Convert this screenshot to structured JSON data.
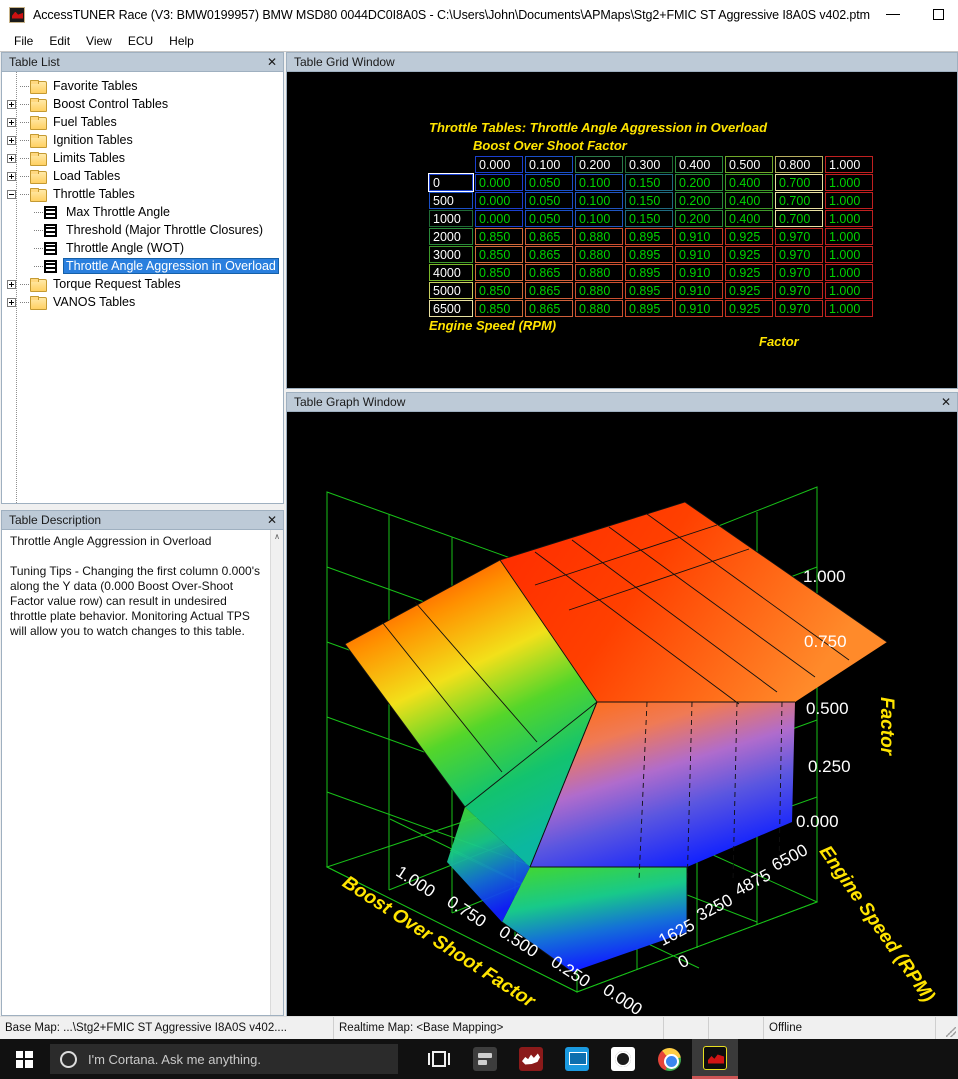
{
  "window": {
    "title": "AccessTUNER Race (V3: BMW0199957) BMW MSD80 0044DC0I8A0S - C:\\Users\\John\\Documents\\APMaps\\Stg2+FMIC ST Aggressive I8A0S v402.ptm",
    "icon": "accesstuner-icon",
    "minimize": "–",
    "maximize": "☐",
    "close": "✕"
  },
  "menu": [
    "File",
    "Edit",
    "View",
    "ECU",
    "Help"
  ],
  "table_list": {
    "header": "Table List",
    "close": "✕",
    "items": [
      {
        "label": "Favorite Tables",
        "type": "folder",
        "expander": "none",
        "selected": false
      },
      {
        "label": "Boost Control Tables",
        "type": "folder",
        "expander": "plus",
        "selected": false
      },
      {
        "label": "Fuel Tables",
        "type": "folder",
        "expander": "plus",
        "selected": false
      },
      {
        "label": "Ignition Tables",
        "type": "folder",
        "expander": "plus",
        "selected": false
      },
      {
        "label": "Limits Tables",
        "type": "folder",
        "expander": "plus",
        "selected": false
      },
      {
        "label": "Load Tables",
        "type": "folder",
        "expander": "plus",
        "selected": false
      },
      {
        "label": "Throttle Tables",
        "type": "folder",
        "expander": "minus",
        "selected": false
      },
      {
        "label": "Max Throttle Angle",
        "type": "table",
        "expander": "none",
        "selected": false
      },
      {
        "label": "Threshold (Major Throttle Closures)",
        "type": "table",
        "expander": "none",
        "selected": false
      },
      {
        "label": "Throttle Angle (WOT)",
        "type": "table",
        "expander": "none",
        "selected": false
      },
      {
        "label": "Throttle Angle Aggression in Overload",
        "type": "table",
        "expander": "none",
        "selected": true
      },
      {
        "label": "Torque Request Tables",
        "type": "folder",
        "expander": "plus",
        "selected": false
      },
      {
        "label": "VANOS Tables",
        "type": "folder",
        "expander": "plus",
        "selected": false
      }
    ]
  },
  "table_description": {
    "header": "Table Description",
    "close": "✕",
    "title": "Throttle Angle Aggression in Overload",
    "body": "Tuning Tips - Changing the first column 0.000's along the Y data (0.000 Boost Over-Shoot Factor value row) can result in undesired throttle plate behavior. Monitoring Actual TPS will allow you to watch changes to this table.",
    "scroll_up": "∧"
  },
  "grid_window": {
    "header": "Table Grid Window",
    "title": "Throttle Tables: Throttle Angle Aggression in Overload",
    "x_axis_title": "Boost Over Shoot Factor",
    "y_axis_title": "Engine Speed (RPM)",
    "unit_label": "Factor"
  },
  "graph_window": {
    "header": "Table Graph Window",
    "close": "✕",
    "z_axis_title": "Factor",
    "x_axis_title": "Boost Over Shoot Factor",
    "y_axis_title": "Engine Speed (RPM)",
    "z_ticks": [
      "1.000",
      "0.750",
      "0.500",
      "0.250",
      "0.000"
    ],
    "y_ticks": [
      "6500",
      "4875",
      "3250",
      "1625",
      "0"
    ],
    "x_ticks": [
      "1.000",
      "0.750",
      "0.500",
      "0.250",
      "0.000"
    ]
  },
  "status_bar": {
    "base_map": "Base Map: ...\\Stg2+FMIC ST Aggressive I8A0S v402....",
    "realtime_map": "Realtime Map: <Base Mapping>",
    "cell3": "",
    "cell4": "",
    "connection": "Offline"
  },
  "taskbar": {
    "start": "start-button",
    "cortana_placeholder": "I'm Cortana. Ask me anything.",
    "icons": [
      {
        "name": "task-view-icon",
        "active": false
      },
      {
        "name": "settings-icon",
        "active": false
      },
      {
        "name": "dragon-app-icon",
        "active": false
      },
      {
        "name": "screen-app-icon",
        "active": false
      },
      {
        "name": "steelseries-icon",
        "active": false
      },
      {
        "name": "chrome-icon",
        "active": false
      },
      {
        "name": "accesstuner-icon",
        "active": true
      }
    ]
  },
  "chart_data": {
    "type": "table",
    "title": "Throttle Tables: Throttle Angle Aggression in Overload",
    "xlabel": "Boost Over Shoot Factor",
    "ylabel": "Engine Speed (RPM)",
    "zlabel": "Factor",
    "columns": [
      "0.000",
      "0.100",
      "0.200",
      "0.300",
      "0.400",
      "0.500",
      "0.800",
      "1.000"
    ],
    "rows": [
      "0",
      "500",
      "1000",
      "2000",
      "3000",
      "4000",
      "5000",
      "6500"
    ],
    "values": [
      [
        "0.000",
        "0.050",
        "0.100",
        "0.150",
        "0.200",
        "0.400",
        "0.700",
        "1.000"
      ],
      [
        "0.000",
        "0.050",
        "0.100",
        "0.150",
        "0.200",
        "0.400",
        "0.700",
        "1.000"
      ],
      [
        "0.000",
        "0.050",
        "0.100",
        "0.150",
        "0.200",
        "0.400",
        "0.700",
        "1.000"
      ],
      [
        "0.850",
        "0.865",
        "0.880",
        "0.895",
        "0.910",
        "0.925",
        "0.970",
        "1.000"
      ],
      [
        "0.850",
        "0.865",
        "0.880",
        "0.895",
        "0.910",
        "0.925",
        "0.970",
        "1.000"
      ],
      [
        "0.850",
        "0.865",
        "0.880",
        "0.895",
        "0.910",
        "0.925",
        "0.970",
        "1.000"
      ],
      [
        "0.850",
        "0.865",
        "0.880",
        "0.895",
        "0.910",
        "0.925",
        "0.970",
        "1.000"
      ],
      [
        "0.850",
        "0.865",
        "0.880",
        "0.895",
        "0.910",
        "0.925",
        "0.970",
        "1.000"
      ]
    ],
    "header_border_colors": [
      "#1a3fd0",
      "#1a4fc8",
      "#2a7a4a",
      "#1f6b35",
      "#2a8a3a",
      "#6fa82a",
      "#b8b060",
      "#c02020"
    ],
    "cell_border_colors": [
      [
        "#1a3fd0",
        "#1a4fc8",
        "#1f55c0",
        "#1f6b80",
        "#2a8a3a",
        "#3f9a2a",
        "#e8e0a0",
        "#c02020"
      ],
      [
        "#1a3fd0",
        "#1a4fc8",
        "#1f55c0",
        "#1f6b80",
        "#2a8a3a",
        "#3f9a2a",
        "#e8e0a0",
        "#c02020"
      ],
      [
        "#1a3fd0",
        "#1a4fc8",
        "#1f55c0",
        "#1f6b80",
        "#2a8a3a",
        "#3f9a2a",
        "#e8e0a0",
        "#c02020"
      ],
      [
        "#d06a3a",
        "#d0603a",
        "#cc5030",
        "#cc4828",
        "#c83c24",
        "#c43020",
        "#c02820",
        "#c02020"
      ],
      [
        "#d06a3a",
        "#d0603a",
        "#cc5030",
        "#cc4828",
        "#c83c24",
        "#c43020",
        "#c02820",
        "#c02020"
      ],
      [
        "#d06a3a",
        "#d0603a",
        "#cc5030",
        "#cc4828",
        "#c83c24",
        "#c43020",
        "#c02820",
        "#c02020"
      ],
      [
        "#d06a3a",
        "#d0603a",
        "#cc5030",
        "#cc4828",
        "#c83c24",
        "#c43020",
        "#c02820",
        "#c02020"
      ],
      [
        "#d06a3a",
        "#d0603a",
        "#cc5030",
        "#cc4828",
        "#c83c24",
        "#c43020",
        "#c02820",
        "#c02020"
      ]
    ],
    "row_label_border_colors": [
      "#1a3fd0",
      "#1a4fc8",
      "#1f6b35",
      "#2a8a3a",
      "#3f9a2a",
      "#7ab82a",
      "#c8d060",
      "#e8e0a0"
    ],
    "surface_description": "3D wireframe surface: high plateau (~0.85-1.00) across RPM 2000-6500, dropping steeply to near 0 at low RPM and low Boost Over Shoot Factor"
  }
}
